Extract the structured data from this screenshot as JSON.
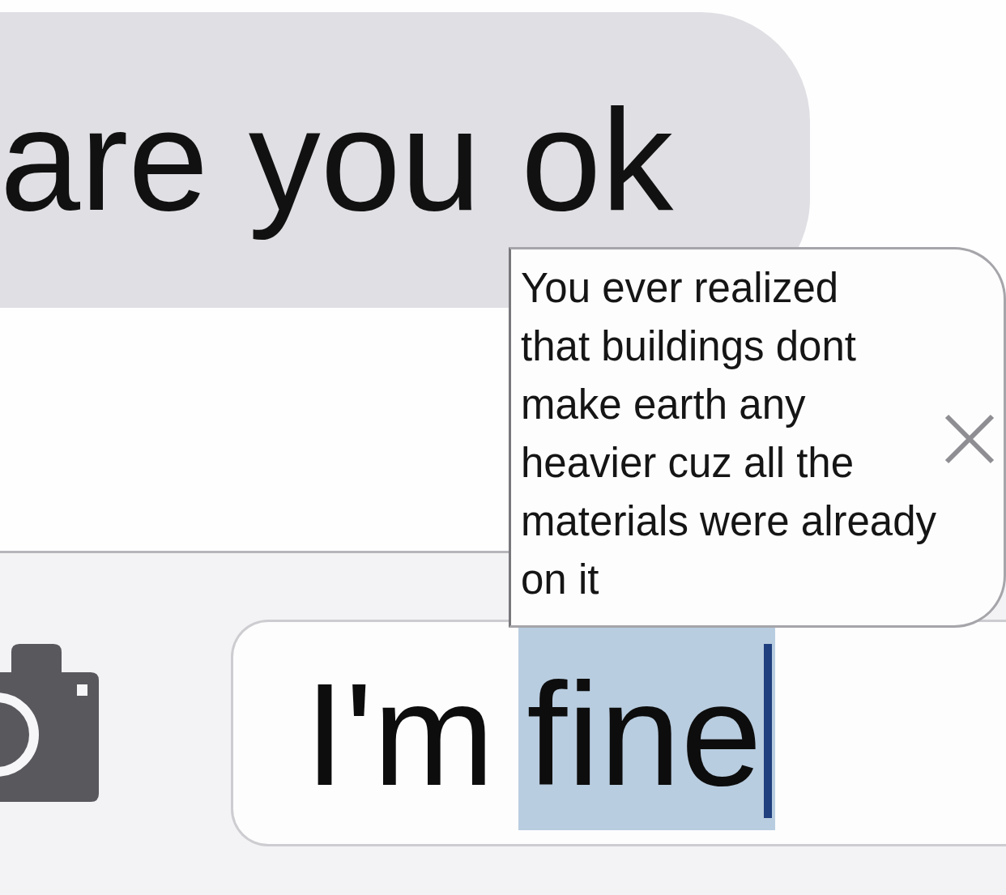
{
  "conversation": {
    "messages": [
      {
        "kind": "received",
        "text": "are you ok"
      }
    ]
  },
  "autocorrect_popup": {
    "lines": [
      "You ever realized",
      "that buildings dont",
      "make earth any",
      "heavier cuz all the",
      "materials were already",
      "on it"
    ]
  },
  "compose_bar": {
    "message_field": {
      "segments": [
        {
          "text": "I'm",
          "highlighted": false
        },
        {
          "text": "fine",
          "highlighted": true
        }
      ],
      "focused": true
    }
  }
}
